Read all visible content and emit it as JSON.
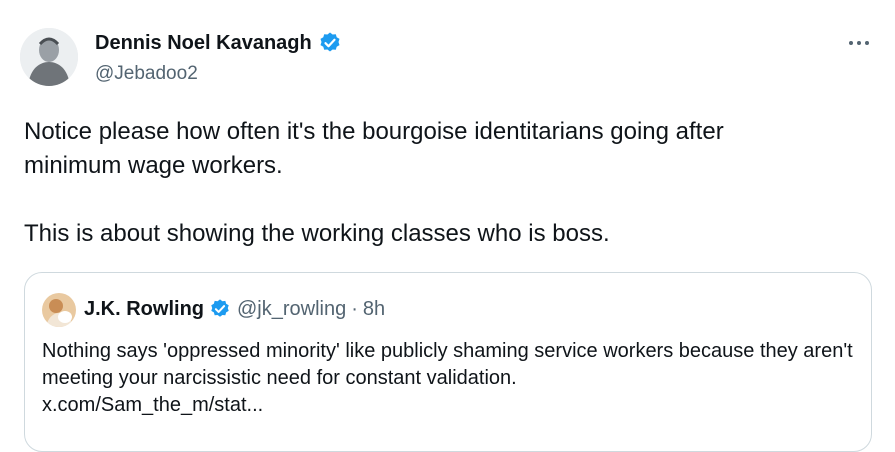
{
  "author": {
    "name": "Dennis Noel Kavanagh",
    "handle": "@Jebadoo2",
    "verified": true
  },
  "tweet": {
    "text": "Notice please how often it's the bourgoise identitarians going after\nminimum wage workers.\n\nThis is about showing the working classes who is boss."
  },
  "more_icon": "more-horizontal-icon",
  "quoted": {
    "name": "J.K. Rowling",
    "handle": "@jk_rowling",
    "dot": "·",
    "time": "8h",
    "verified": true,
    "text": "Nothing says 'oppressed minority' like publicly shaming service workers because they aren't meeting your narcissistic need for constant validation.",
    "link": "x.com/Sam_the_m/stat..."
  },
  "colors": {
    "verified_blue": "#1d9bf0",
    "text": "#0f1419",
    "secondary": "#536471",
    "border": "#cfd9de"
  }
}
